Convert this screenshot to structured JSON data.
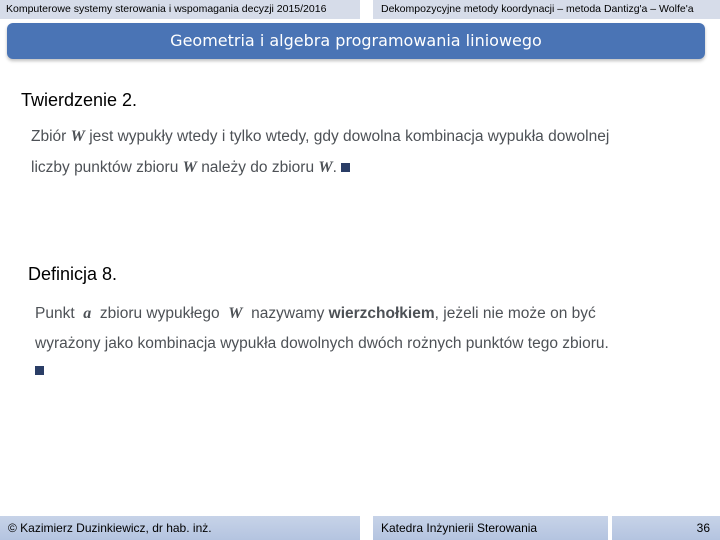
{
  "header": {
    "left": "Komputerowe systemy sterowania i wspomagania decyzji 2015/2016",
    "right": "Dekompozycyjne metody koordynacji – metoda Dantizg'a – Wolfe'a"
  },
  "slide": {
    "title": "Geometria i algebra programowania liniowego",
    "theorem": {
      "heading": "Twierdzenie 2.",
      "line1_a": "Zbiór",
      "line1_sym": "W",
      "line1_b": "jest wypukły wtedy i tylko wtedy, gdy dowolna kombinacja wypukła dowolnej",
      "line2_a": "liczby punktów zbioru",
      "line2_sym": "W",
      "line2_b": "należy do zbioru",
      "line2_sym2": "W",
      "line2_c": ".",
      "end_mark": "square"
    },
    "definition": {
      "heading": "Definicja 8.",
      "line1_a": "Punkt",
      "line1_sym": "a",
      "line1_b": "zbioru wypukłego",
      "line1_sym2": "W",
      "line1_c": "nazywamy",
      "line1_bold": "wierzchołkiem",
      "line1_d": ", jeżeli nie może on być",
      "line2": "wyrażony jako kombinacja wypukła dowolnych dwóch rożnych punktów tego zbioru.",
      "end_mark": "square"
    }
  },
  "footer": {
    "author": "© Kazimierz Duzinkiewicz, dr hab. inż.",
    "department": "Katedra Inżynierii Sterowania",
    "page_number": "36"
  },
  "colors": {
    "header_bg": "#d6dce9",
    "title_bg": "#4a74b5",
    "footer_bg": "#b4c4e0",
    "body_text": "#4d5156"
  }
}
